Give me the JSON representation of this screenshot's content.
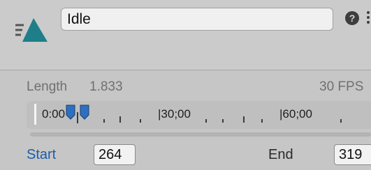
{
  "header": {
    "icon": "animation-clip-icon",
    "clip_name": "Idle",
    "help_glyph": "?"
  },
  "properties": {
    "length_label": "Length",
    "length_value": "1.833",
    "fps_label": "30 FPS"
  },
  "timeline": {
    "labels": [
      "0:00",
      "|30;00",
      "|60;00"
    ]
  },
  "range": {
    "start_label": "Start",
    "start_value": "264",
    "end_label": "End",
    "end_value": "319"
  },
  "colors": {
    "icon_teal": "#1e7f8a",
    "marker_blue": "#2f6fc0",
    "link_blue": "#1e5ca8"
  }
}
